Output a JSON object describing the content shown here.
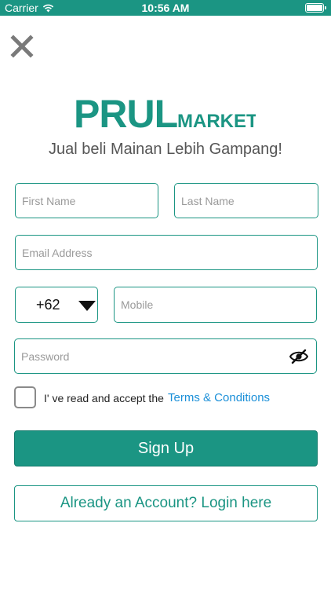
{
  "status_bar": {
    "carrier": "Carrier",
    "time": "10:56 AM",
    "wifi_icon": "wifi-icon",
    "battery_icon": "battery-icon"
  },
  "header": {
    "close_icon": "close-icon"
  },
  "brand": {
    "logo_primary": "PRUL",
    "logo_secondary": "MARKET",
    "tagline": "Jual beli Mainan Lebih Gampang!",
    "color": "#1b9583"
  },
  "form": {
    "first_name": {
      "value": "",
      "placeholder": "First Name"
    },
    "last_name": {
      "value": "",
      "placeholder": "Last Name"
    },
    "email": {
      "value": "",
      "placeholder": "Email Address"
    },
    "country_code": {
      "selected": "+62"
    },
    "mobile": {
      "value": "",
      "placeholder": "Mobile"
    },
    "password": {
      "value": "",
      "placeholder": "Password",
      "toggle_icon": "eye-slash-icon"
    },
    "terms": {
      "checked": false,
      "text": "I' ve read and accept the",
      "link": "Terms & Conditions",
      "link_color": "#1a8fd8"
    }
  },
  "actions": {
    "signup_label": "Sign Up",
    "login_label": "Already an Account? Login here"
  }
}
